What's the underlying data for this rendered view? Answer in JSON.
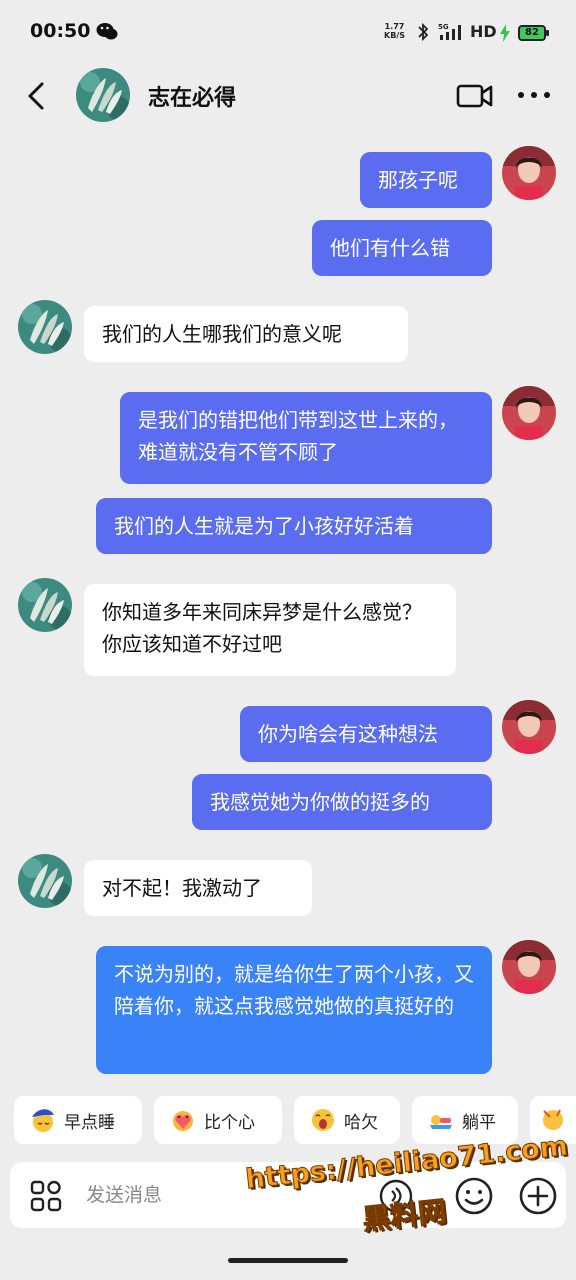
{
  "status_bar": {
    "time": "00:50",
    "net_speed_value": "1.77",
    "net_speed_unit": "KB/S",
    "signal_label": "5G",
    "hd_label": "HD",
    "battery_level": "82"
  },
  "header": {
    "title": "志在必得"
  },
  "messages": [
    {
      "sender": "me",
      "text": "那孩子呢"
    },
    {
      "sender": "me",
      "text": "他们有什么错"
    },
    {
      "sender": "other",
      "text": "我们的人生哪我们的意义呢"
    },
    {
      "sender": "me",
      "text": "是我们的错把他们带到这世上来的，难道就没有不管不顾了"
    },
    {
      "sender": "me",
      "text": "我们的人生就是为了小孩好好活着"
    },
    {
      "sender": "other",
      "text": "你知道多年来同床异梦是什么感觉？你应该知道不好过吧"
    },
    {
      "sender": "me",
      "text": "你为啥会有这种想法"
    },
    {
      "sender": "me",
      "text": "我感觉她为你做的挺多的"
    },
    {
      "sender": "other",
      "text": "对不起！我激动了"
    },
    {
      "sender": "me",
      "text": "不说为别的，就是给你生了两个小孩，又陪着你，就这点我感觉她做的真挺好的"
    }
  ],
  "quick_replies": [
    {
      "label": "早点睡",
      "icon": "sleep-emoji-icon"
    },
    {
      "label": "比个心",
      "icon": "heart-emoji-icon"
    },
    {
      "label": "哈欠",
      "icon": "yawn-emoji-icon"
    },
    {
      "label": "躺平",
      "icon": "lie-flat-emoji-icon"
    }
  ],
  "input": {
    "placeholder": "发送消息"
  },
  "watermark": {
    "url": "https://heiliao71.com",
    "name": "黑料网"
  },
  "colors": {
    "my_bubble": "#5a6cf0",
    "my_bubble_last": "#3a82f7",
    "other_bubble": "#ffffff",
    "background": "#ededed",
    "watermark": "#f7a21b"
  }
}
